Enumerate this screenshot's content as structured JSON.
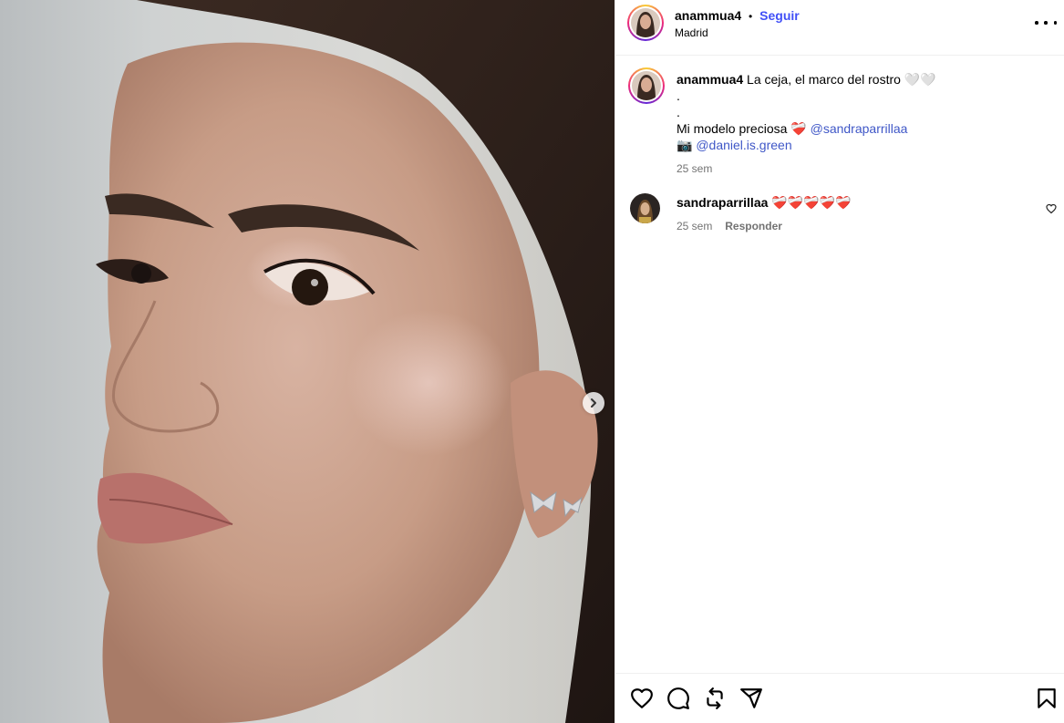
{
  "post": {
    "author": "anammua4",
    "separator": "•",
    "follow_label": "Seguir",
    "location": "Madrid",
    "more_label": "more-options",
    "caption": {
      "username": "anammua4",
      "line1": "La ceja, el marco del rostro 🤍🤍",
      "line2": ".",
      "line3": ".",
      "line4_text": "Mi modelo preciosa",
      "line4_emoji": "❤️‍🩹",
      "line4_mention": "@sandraparrillaa",
      "line5_emoji": "📷",
      "line5_mention": "@daniel.is.green",
      "time": "25 sem"
    },
    "comments": [
      {
        "username": "sandraparrillaa",
        "text": "❤️‍🩹❤️‍🩹❤️‍🩹❤️‍🩹❤️‍🩹",
        "time": "25 sem",
        "reply_label": "Responder"
      }
    ]
  },
  "icons": {
    "like": "heart-icon",
    "comment": "comment-icon",
    "repost": "repost-icon",
    "share": "share-icon",
    "save": "bookmark-icon",
    "next": "chevron-right-icon"
  },
  "colors": {
    "accent": "#4150f7",
    "mention": "#3f57c7",
    "muted": "#737373",
    "border": "#efefef"
  }
}
